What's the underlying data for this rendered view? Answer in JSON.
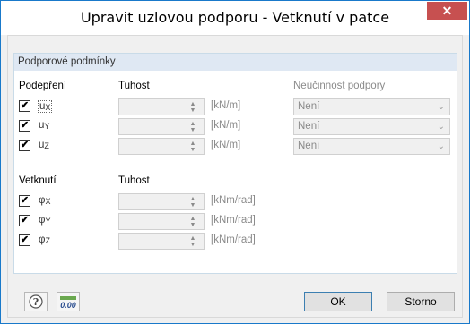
{
  "window": {
    "title": "Upravit uzlovou podporu - Vetknutí v patce",
    "close_glyph": "✕"
  },
  "group": {
    "title": "Podporové podmínky"
  },
  "support": {
    "header": "Podepření",
    "stiffness_header": "Tuhost",
    "ineffectiveness_header": "Neúčinnost podpory",
    "rows": [
      {
        "symbol": "u",
        "sub": "X",
        "checked": true,
        "unit": "[kN/m]",
        "ineffectiveness": "Není"
      },
      {
        "symbol": "u",
        "sub": "Y",
        "checked": true,
        "unit": "[kN/m]",
        "ineffectiveness": "Není"
      },
      {
        "symbol": "u",
        "sub": "Z",
        "checked": true,
        "unit": "[kN/m]",
        "ineffectiveness": "Není"
      }
    ]
  },
  "restraint": {
    "header": "Vetknutí",
    "stiffness_header": "Tuhost",
    "rows": [
      {
        "symbol": "φ",
        "sub": "X",
        "checked": true,
        "unit": "[kNm/rad]"
      },
      {
        "symbol": "φ",
        "sub": "Y",
        "checked": true,
        "unit": "[kNm/rad]"
      },
      {
        "symbol": "φ",
        "sub": "Z",
        "checked": true,
        "unit": "[kNm/rad]"
      }
    ]
  },
  "footer": {
    "help_icon": "help-icon",
    "units_icon_text": "0.00",
    "ok_label": "OK",
    "cancel_label": "Storno"
  }
}
